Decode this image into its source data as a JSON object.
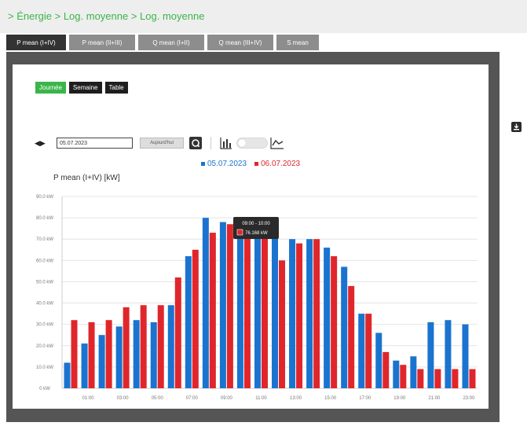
{
  "breadcrumb": "> Énergie > Log. moyenne > Log. moyenne",
  "tabs": [
    {
      "label": "P mean (I+IV)",
      "active": true
    },
    {
      "label": "P mean (II+III)",
      "active": false
    },
    {
      "label": "Q mean (I+II)",
      "active": false
    },
    {
      "label": "Q mean (III+IV)",
      "active": false
    },
    {
      "label": "S mean",
      "active": false
    }
  ],
  "view_buttons": [
    {
      "label": "Journée",
      "active": true
    },
    {
      "label": "Semaine",
      "active": false
    },
    {
      "label": "Table",
      "active": false
    }
  ],
  "controls": {
    "nav_arrows": "◀▶",
    "date_value": "05.07.2023",
    "today_label": "Aujourd'hui"
  },
  "colors": {
    "series1": "#1a74cf",
    "series2": "#e0262b",
    "accent": "#3ab54a"
  },
  "icons": {
    "export": "download-icon",
    "refresh": "refresh-icon",
    "bar_chart": "bar-chart-icon",
    "line_chart": "line-chart-icon"
  },
  "chart_data": {
    "type": "bar",
    "title": "",
    "ylabel": "P mean (I+IV) [kW]",
    "xlabel": "",
    "ylim": [
      0,
      90
    ],
    "y_ticks": [
      0,
      10,
      20,
      30,
      40,
      50,
      60,
      70,
      80,
      90
    ],
    "y_tick_labels": [
      "0 kW",
      "10.0 kW",
      "20.0 kW",
      "30.0 kW",
      "40.0 kW",
      "50.0 kW",
      "60.0 kW",
      "70.0 kW",
      "80.0 kW",
      "90.0 kW"
    ],
    "categories": [
      "00:00",
      "01:00",
      "02:00",
      "03:00",
      "04:00",
      "05:00",
      "06:00",
      "07:00",
      "08:00",
      "09:00",
      "10:00",
      "11:00",
      "12:00",
      "13:00",
      "14:00",
      "15:00",
      "16:00",
      "17:00",
      "18:00",
      "19:00",
      "20:00",
      "21:00",
      "22:00",
      "23:00"
    ],
    "x_tick_labels": [
      "01:00",
      "03:00",
      "05:00",
      "07:00",
      "09:00",
      "11:00",
      "13:00",
      "15:00",
      "17:00",
      "19:00",
      "21:00",
      "23:00"
    ],
    "legend_position": "top-center",
    "grid": true,
    "series": [
      {
        "name": "05.07.2023",
        "values": [
          12,
          21,
          25,
          29,
          32,
          31,
          39,
          62,
          80,
          78,
          78,
          75,
          74,
          70,
          70,
          66,
          57,
          35,
          26,
          13,
          15,
          31,
          32,
          30
        ]
      },
      {
        "name": "06.07.2023",
        "values": [
          32,
          31,
          32,
          38,
          39,
          39,
          52,
          65,
          73,
          77,
          77,
          76,
          60,
          68,
          70,
          62,
          48,
          35,
          17,
          11,
          9,
          9,
          9,
          9
        ]
      }
    ],
    "tooltip": {
      "time": "09:00 - 10:00",
      "value": "76.168 kW"
    }
  }
}
